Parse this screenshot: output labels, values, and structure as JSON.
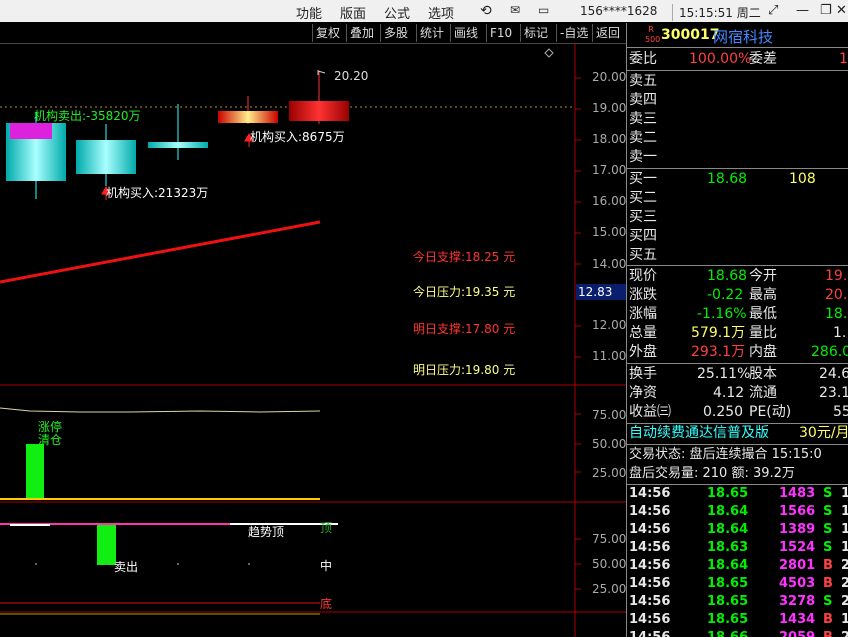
{
  "titlebar": {
    "menus": [
      "功能",
      "版面",
      "公式",
      "选项"
    ],
    "account": "156****1628",
    "clock": "15:15:51 周二"
  },
  "toolbar": {
    "buttons": [
      "复权",
      "叠加",
      "多股",
      "统计",
      "画线",
      "F10",
      "标记",
      "-自选",
      "返回"
    ]
  },
  "chart": {
    "price_axis": [
      "20.00",
      "19.00",
      "18.00",
      "17.00",
      "16.00",
      "15.00",
      "14.00",
      "13.00",
      "12.00",
      "11.00"
    ],
    "cursor_price": "12.83",
    "high_label": "20.20",
    "annotations": {
      "inst_sell": "机构卖出:-35820万",
      "inst_buy1": "机构买入:21323万",
      "inst_buy2": "机构买入:8675万",
      "support_today": "今日支撑:18.25 元",
      "pressure_today": "今日压力:19.35 元",
      "support_tomorrow": "明日支撑:17.80 元",
      "pressure_tomorrow": "明日压力:19.80 元"
    },
    "ind1_axis": [
      "75.00",
      "50.00",
      "25.00"
    ],
    "ind1_labels": [
      "涨停",
      "清仓"
    ],
    "ind2_axis": [
      "75.00",
      "50.00",
      "25.00"
    ],
    "ind2_labels": {
      "trend": "趋势顶",
      "sell": "卖出",
      "top": "顶",
      "mid": "中",
      "bottom": "底"
    }
  },
  "quote": {
    "badge_top": "R",
    "badge_bottom": "500",
    "code": "300017",
    "name": "网宿科技",
    "weibi_label": "委比",
    "weibi_value": "100.00%",
    "weicha_label": "委差",
    "weicha_value": "1",
    "sells": [
      "卖五",
      "卖四",
      "卖三",
      "卖二",
      "卖一"
    ],
    "buys": [
      {
        "label": "买一",
        "price": "18.68",
        "vol": "108"
      },
      {
        "label": "买二",
        "price": "",
        "vol": ""
      },
      {
        "label": "买三",
        "price": "",
        "vol": ""
      },
      {
        "label": "买四",
        "price": "",
        "vol": ""
      },
      {
        "label": "买五",
        "price": "",
        "vol": ""
      }
    ],
    "stats": [
      {
        "l1": "现价",
        "v1": "18.68",
        "l2": "今开",
        "v2": "19."
      },
      {
        "l1": "涨跌",
        "v1": "-0.22",
        "l2": "最高",
        "v2": "20."
      },
      {
        "l1": "涨幅",
        "v1": "-1.16%",
        "l2": "最低",
        "v2": "18."
      },
      {
        "l1": "总量",
        "v1": "579.1万",
        "l2": "量比",
        "v2": "1."
      },
      {
        "l1": "外盘",
        "v1": "293.1万",
        "l2": "内盘",
        "v2": "286.0"
      }
    ],
    "stats2": [
      {
        "l1": "换手",
        "v1": "25.11%",
        "l2": "股本",
        "v2": "24.6"
      },
      {
        "l1": "净资",
        "v1": "4.12",
        "l2": "流通",
        "v2": "23.1"
      },
      {
        "l1": "收益㈢",
        "v1": "0.250",
        "l2": "PE(动)",
        "v2": "55"
      }
    ],
    "promo": "自动续费通达信普及版",
    "promo_price": "30元/月",
    "trade_state": "交易状态: 盘后连续撮合 15:15:0",
    "after_hours": "盘后交易量: 210  额: 39.2万",
    "ticks": [
      {
        "t": "14:56",
        "p": "18.65",
        "v": "1483",
        "s": "S"
      },
      {
        "t": "14:56",
        "p": "18.64",
        "v": "1566",
        "s": "S"
      },
      {
        "t": "14:56",
        "p": "18.64",
        "v": "1389",
        "s": "S"
      },
      {
        "t": "14:56",
        "p": "18.63",
        "v": "1524",
        "s": "S"
      },
      {
        "t": "14:56",
        "p": "18.64",
        "v": "2801",
        "s": "B"
      },
      {
        "t": "14:56",
        "p": "18.65",
        "v": "4503",
        "s": "B"
      },
      {
        "t": "14:56",
        "p": "18.65",
        "v": "3278",
        "s": "S"
      },
      {
        "t": "14:56",
        "p": "18.65",
        "v": "1434",
        "s": "B"
      },
      {
        "t": "14:56",
        "p": "18.66",
        "v": "2059",
        "s": "B"
      }
    ],
    "tick_tails": [
      "1",
      "1",
      "1",
      "1",
      "2",
      "2",
      "2",
      "1",
      "2"
    ]
  }
}
